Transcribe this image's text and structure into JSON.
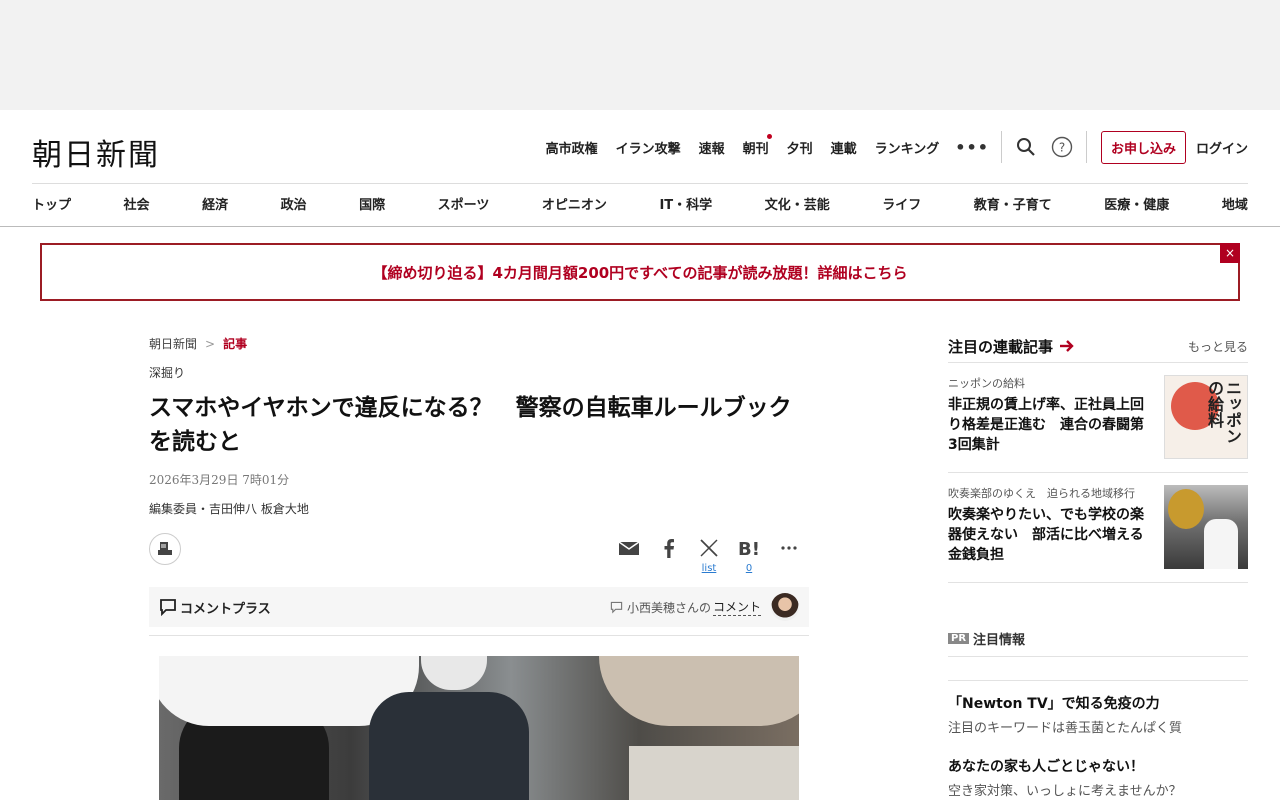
{
  "header": {
    "logo": "朝日新聞",
    "top_links": [
      "高市政権",
      "イラン攻撃",
      "速報",
      "朝刊",
      "夕刊",
      "連載",
      "ランキング"
    ],
    "more": "•••",
    "subscribe": "お申し込み",
    "login": "ログイン"
  },
  "nav": {
    "items": [
      "トップ",
      "社会",
      "経済",
      "政治",
      "国際",
      "スポーツ",
      "オピニオン",
      "IT・科学",
      "文化・芸能",
      "ライフ",
      "教育・子育て",
      "医療・健康",
      "地域"
    ]
  },
  "promo": {
    "text": "【締め切り迫る】4カ月間月額200円ですべての記事が読み放題！詳細はこちら",
    "close": "×"
  },
  "article": {
    "breadcrumb": [
      "朝日新聞",
      "記事"
    ],
    "breadcrumb_sep": ">",
    "section": "深掘り",
    "title": "スマホやイヤホンで違反になる？　警察の自転車ルールブックを読むと",
    "date": "2026年3月29日 7時01分",
    "byline": "編集委員・吉田伸八 板倉大地",
    "share": {
      "x_count": "list",
      "hatena_count": "0"
    },
    "comment_plus": {
      "label": "コメントプラス",
      "author_text": "小西美穂さんの",
      "comment_link": "コメント"
    }
  },
  "sidebar": {
    "title": "注目の連載記事",
    "more": "もっと見る",
    "cards": [
      {
        "category": "ニッポンの給料",
        "headline": "非正規の賃上げ率、正社員上回り格差是正進む　連合の春闘第3回集計",
        "thumb_text": "ニッポンの給料"
      },
      {
        "category": "吹奏楽部のゆくえ　迫られる地域移行",
        "headline": "吹奏楽やりたい、でも学校の楽器使えない　部活に比べ増える金銭負担"
      }
    ],
    "pr": {
      "badge": "PR",
      "title": "注目情報",
      "items": [
        {
          "title": "「Newton TV」で知る免疫の力",
          "sub": "注目のキーワードは善玉菌とたんぱく質"
        },
        {
          "title": "あなたの家も人ごとじゃない！",
          "sub": "空き家対策、いっしょに考えませんか？"
        }
      ]
    }
  },
  "colors": {
    "accent": "#b00020",
    "link": "#2a7bd0"
  },
  "icons": {
    "search": "search-icon",
    "help": "help-icon",
    "print": "print-icon",
    "mail": "mail-icon",
    "facebook": "facebook-icon",
    "x": "x-icon",
    "hatena": "hatena-bookmark-icon",
    "more": "more-icon",
    "comment": "comment-icon",
    "arrow": "arrow-right-icon"
  }
}
